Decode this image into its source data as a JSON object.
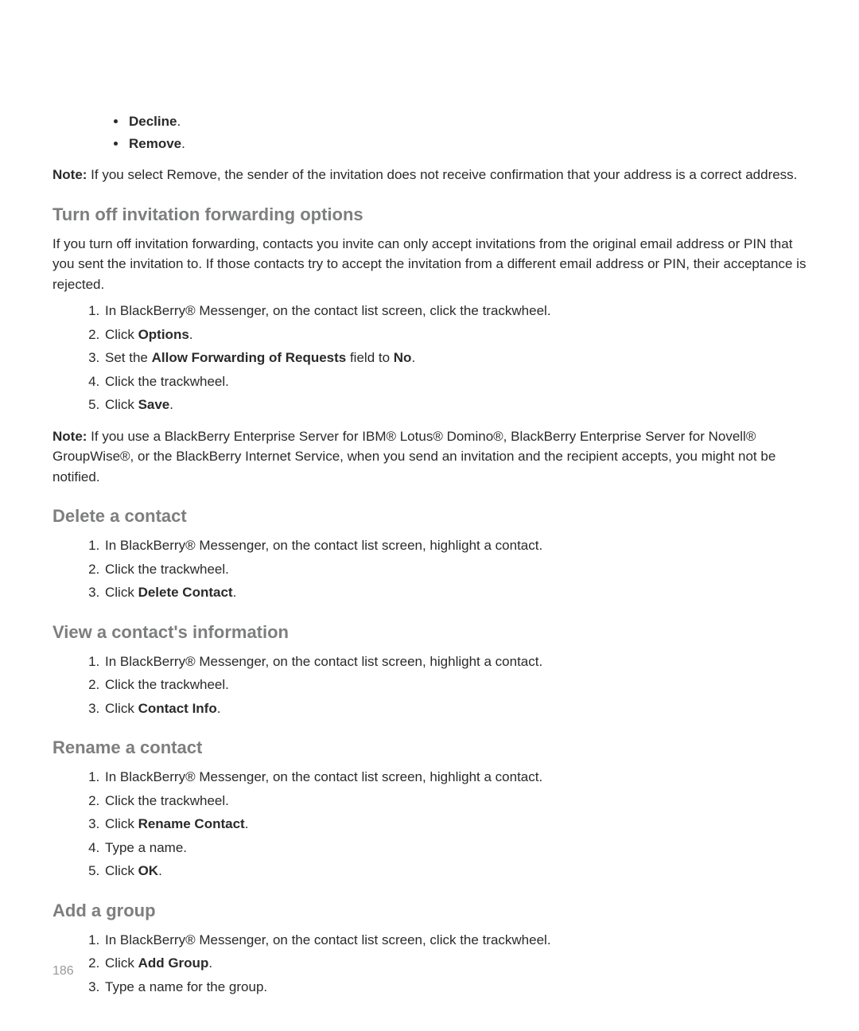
{
  "page_number": "186",
  "top_bullets": {
    "items": [
      "Decline",
      "Remove"
    ]
  },
  "note1": {
    "label": "Note:",
    "text": "  If you select Remove, the sender of the invitation does not receive confirmation that your address is a correct address."
  },
  "sections": {
    "forwarding": {
      "title": "Turn off invitation forwarding options",
      "intro": "If you turn off invitation forwarding, contacts you invite can only accept invitations from the original email address or PIN that you sent the invitation to. If those contacts try to accept the invitation from a different email address or PIN, their acceptance is rejected.",
      "steps": [
        {
          "pre": "In BlackBerry® Messenger, on the contact list screen, click the trackwheel."
        },
        {
          "pre": "Click ",
          "bold": "Options",
          "post": "."
        },
        {
          "pre": "Set the ",
          "bold": "Allow Forwarding of Requests",
          "mid": " field to ",
          "bold2": "No",
          "post": "."
        },
        {
          "pre": "Click the trackwheel."
        },
        {
          "pre": "Click ",
          "bold": "Save",
          "post": "."
        }
      ],
      "note": {
        "label": "Note:",
        "text": "  If you use a BlackBerry Enterprise Server for IBM® Lotus® Domino®, BlackBerry Enterprise Server for Novell® GroupWise®, or the BlackBerry Internet Service, when you send an invitation and the recipient accepts, you might not be notified."
      }
    },
    "delete_contact": {
      "title": "Delete a contact",
      "steps": [
        {
          "pre": "In BlackBerry® Messenger, on the contact list screen, highlight a contact."
        },
        {
          "pre": "Click the trackwheel."
        },
        {
          "pre": "Click ",
          "bold": "Delete Contact",
          "post": "."
        }
      ]
    },
    "view_contact": {
      "title": "View a contact's information",
      "steps": [
        {
          "pre": "In BlackBerry® Messenger, on the contact list screen, highlight a contact."
        },
        {
          "pre": "Click the trackwheel."
        },
        {
          "pre": "Click ",
          "bold": "Contact Info",
          "post": "."
        }
      ]
    },
    "rename_contact": {
      "title": "Rename a contact",
      "steps": [
        {
          "pre": "In BlackBerry® Messenger, on the contact list screen, highlight a contact."
        },
        {
          "pre": "Click the trackwheel."
        },
        {
          "pre": "Click ",
          "bold": "Rename Contact",
          "post": "."
        },
        {
          "pre": "Type a name."
        },
        {
          "pre": "Click ",
          "bold": "OK",
          "post": "."
        }
      ]
    },
    "add_group": {
      "title": "Add a group",
      "steps": [
        {
          "pre": "In BlackBerry® Messenger, on the contact list screen, click the trackwheel."
        },
        {
          "pre": "Click ",
          "bold": "Add Group",
          "post": "."
        },
        {
          "pre": "Type a name for the group."
        }
      ]
    }
  }
}
